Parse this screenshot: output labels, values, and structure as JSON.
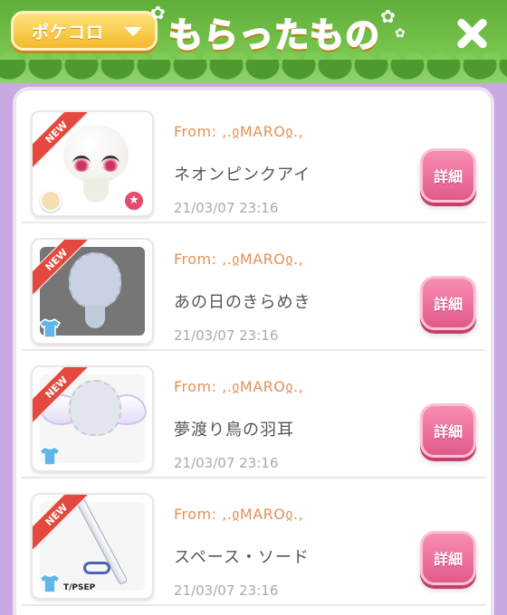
{
  "header": {
    "pokecoro_label": "ポケコロ",
    "title": "もらったもの"
  },
  "items": [
    {
      "new_badge": "NEW",
      "from": "From: ,.ჲMAROჲ.,",
      "name": "ネオンピンクアイ",
      "date": "21/03/07 23:16",
      "detail_label": "詳細",
      "type_icon": "pokemon-face-icon"
    },
    {
      "new_badge": "NEW",
      "from": "From: ,.ჲMAROჲ.,",
      "name": "あの日のきらめき",
      "date": "21/03/07 23:16",
      "detail_label": "詳細",
      "type_icon": "clothing-icon"
    },
    {
      "new_badge": "NEW",
      "from": "From: ,.ჲMAROჲ.,",
      "name": "夢渡り鳥の羽耳",
      "date": "21/03/07 23:16",
      "detail_label": "詳細",
      "type_icon": "clothing-icon"
    },
    {
      "new_badge": "NEW",
      "from": "From: ,.ჲMAROჲ.,",
      "name": "スペース・ソード",
      "date": "21/03/07 23:16",
      "detail_label": "詳細",
      "type_icon": "clothing-icon",
      "tag": "T/PSEP"
    }
  ],
  "colors": {
    "background": "#c7a9e3",
    "header_green": "#74c24a",
    "title_orange": "#ffb62a",
    "from_orange": "#e39257",
    "detail_pink": "#e25a8c",
    "new_red": "#e4483e"
  }
}
